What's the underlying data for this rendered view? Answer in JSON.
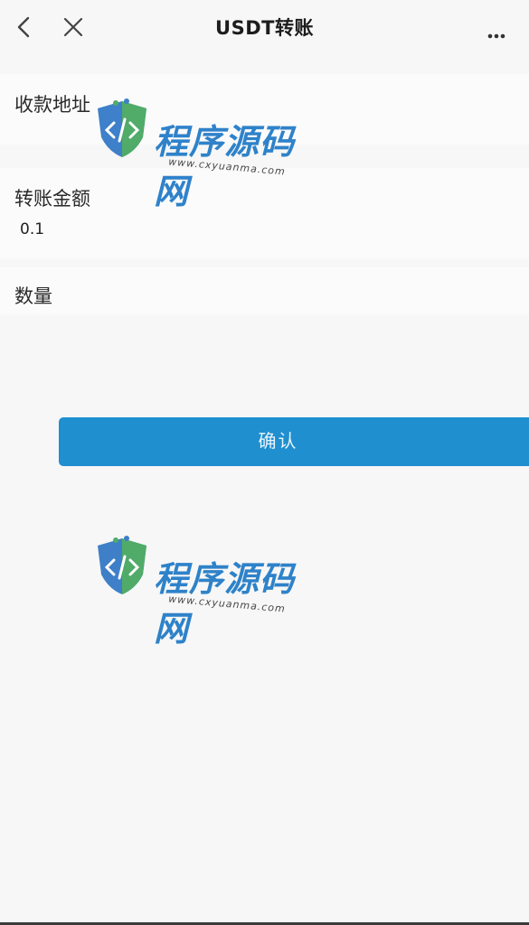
{
  "header": {
    "title": "USDT转账",
    "back_icon": "chevron-left-icon",
    "close_icon": "close-icon",
    "more_icon": "more-horizontal-icon"
  },
  "form": {
    "address_label": "收款地址",
    "amount_label": "转账金额",
    "amount_value": "0.1",
    "quantity_label": "数量"
  },
  "actions": {
    "confirm_label": "确认"
  },
  "watermark": {
    "brand": "程序源码网",
    "url": "www.cxyuanma.com"
  },
  "colors": {
    "accent": "#1f8fcf",
    "background": "#f7f7f7"
  }
}
